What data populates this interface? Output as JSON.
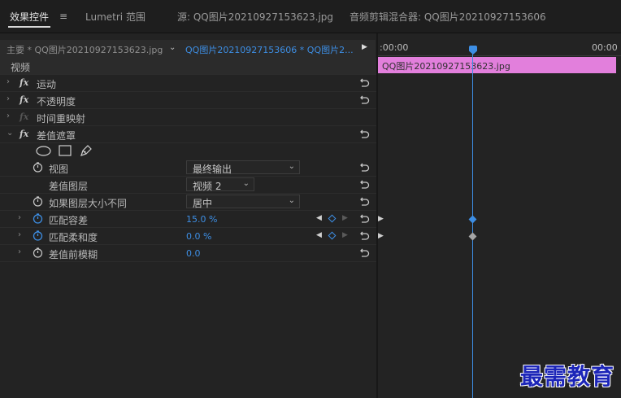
{
  "tabs": {
    "effect_controls": "效果控件",
    "lumetri": "Lumetri 范围",
    "source": "源: QQ图片20210927153623.jpg",
    "audio_mixer": "音频剪辑混合器: QQ图片20210927153606"
  },
  "source_row": {
    "master": "主要 * QQ图片20210927153623.jpg",
    "sequence": "QQ图片20210927153606 * QQ图片2..."
  },
  "timeline": {
    "time_start": ":00:00",
    "time_end": "00:00",
    "clip_label": "QQ图片20210927153623.jpg",
    "clip_color": "#e27fdc",
    "playhead_color": "#3d8ee4"
  },
  "panel": {
    "section_video": "视频",
    "effects": [
      {
        "label": "运动",
        "fx_dim": false
      },
      {
        "label": "不透明度",
        "fx_dim": false
      },
      {
        "label": "时间重映射",
        "fx_dim": true
      },
      {
        "label": "差值遮罩",
        "fx_dim": false
      }
    ],
    "params": {
      "view_label": "视图",
      "view_value": "最终输出",
      "layer_label": "差值图层",
      "layer_value": "视频 2",
      "size_label": "如果图层大小不同",
      "size_value": "居中",
      "tolerance_label": "匹配容差",
      "tolerance_value": "15.0 %",
      "softness_label": "匹配柔和度",
      "softness_value": "0.0 %",
      "blur_label": "差值前模糊",
      "blur_value": "0.0"
    }
  },
  "watermark": "最需教育",
  "icons": [
    "menu-icon",
    "chevron-down-icon",
    "play-triangle-icon",
    "reset-icon",
    "stopwatch-icon",
    "ellipse-mask-icon",
    "rectangle-mask-icon",
    "pen-mask-icon",
    "keyframe-icon"
  ]
}
